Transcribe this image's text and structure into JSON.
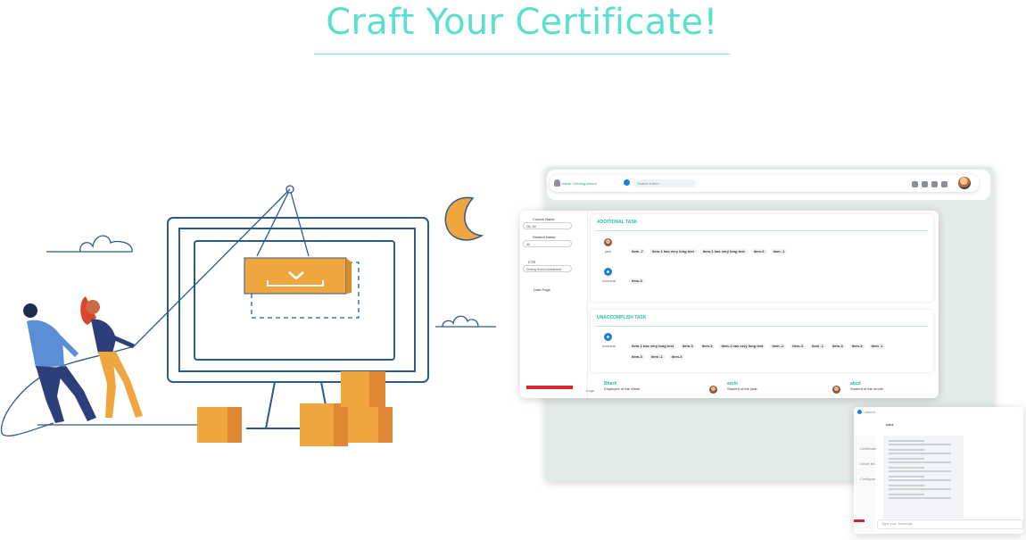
{
  "title": "Craft Your Certificate!",
  "topbar": {
    "breadcrumb": "name / Driving school",
    "search_placeholder": "Search a item"
  },
  "sidebar": {
    "course_label": "Course Name",
    "course_value": "DIL-Dil",
    "student_label": "Student Name",
    "student_value": "All",
    "ctr_label": "CTR",
    "ctr_value": "Driving School Advanced",
    "date_label": "Date Page"
  },
  "additional_task": {
    "title": "ADDITIONAL TASK",
    "row1_user": "jack",
    "row1_items": [
      "item -7",
      "item-1 has very long text",
      "item-1 has very long text",
      "item-3",
      "item -1"
    ],
    "row2_user": "Archana",
    "row2_items": [
      "item-3"
    ]
  },
  "unaccomplish_task": {
    "title": "UNACCOMPLISH TASK",
    "row1_user": "Archana",
    "row1_items": [
      "item-1 has very long text",
      "item-3",
      "item-3",
      "item-1 has very long text",
      "item -1",
      "item-3",
      "item -1",
      "item-3",
      "item-3",
      "item -1"
    ],
    "row2_items": [
      "item-3",
      "item -1",
      "item-3"
    ]
  },
  "footer": {
    "logo_label": "Logo",
    "people": [
      {
        "name": "Bharti",
        "role": "Employee of the Week"
      },
      {
        "name": "archi",
        "role": "Student of the year"
      },
      {
        "name": "abcd",
        "role": "Student of the month"
      }
    ]
  },
  "chat": {
    "search_placeholder": "search",
    "header_name": "kaka",
    "input_placeholder": "Type your Message",
    "side_items": [
      "Certificate",
      "Driver list",
      "Configure"
    ]
  },
  "colors": {
    "title": "#5ae0cc",
    "accent": "#29bfa6",
    "monitor_line": "#2c5a8c",
    "box_orange": "#f0a63e"
  }
}
